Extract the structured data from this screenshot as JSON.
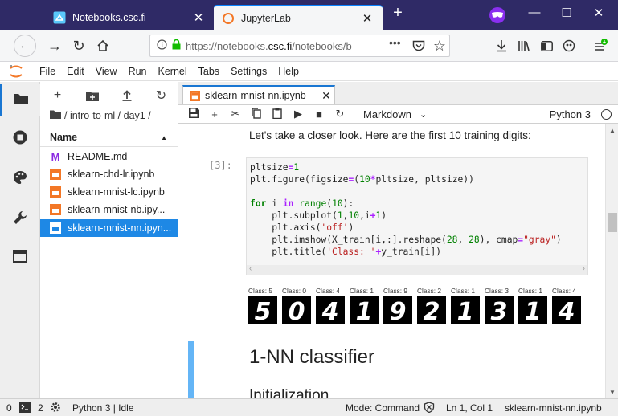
{
  "browser": {
    "tabs": [
      {
        "title": "Notebooks.csc.fi",
        "active": false
      },
      {
        "title": "JupyterLab",
        "active": true
      }
    ],
    "url": {
      "prefix": "https://notebooks.",
      "host": "csc.fi",
      "path": "/notebooks/b"
    }
  },
  "menu": [
    "File",
    "Edit",
    "View",
    "Run",
    "Kernel",
    "Tabs",
    "Settings",
    "Help"
  ],
  "filebrowser": {
    "breadcrumb": "/ intro-to-ml / day1 /",
    "column_name": "Name",
    "files": [
      {
        "name": "README.md",
        "type": "markdown"
      },
      {
        "name": "sklearn-chd-lr.ipynb",
        "type": "notebook"
      },
      {
        "name": "sklearn-mnist-lc.ipynb",
        "type": "notebook"
      },
      {
        "name": "sklearn-mnist-nb.ipy...",
        "type": "notebook"
      },
      {
        "name": "sklearn-mnist-nn.ipyn...",
        "type": "notebook",
        "selected": true
      }
    ]
  },
  "notebook": {
    "tab_title": "sklearn-mnist-nn.ipynb",
    "cell_type": "Markdown",
    "kernel": "Python 3",
    "markdown_text": "Let's take a closer look. Here are the first 10 training digits:",
    "prompt": "[3]:",
    "digits": [
      {
        "label": "Class: 5",
        "digit": "5"
      },
      {
        "label": "Class: 0",
        "digit": "0"
      },
      {
        "label": "Class: 4",
        "digit": "4"
      },
      {
        "label": "Class: 1",
        "digit": "1"
      },
      {
        "label": "Class: 9",
        "digit": "9"
      },
      {
        "label": "Class: 2",
        "digit": "2"
      },
      {
        "label": "Class: 1",
        "digit": "1"
      },
      {
        "label": "Class: 3",
        "digit": "3"
      },
      {
        "label": "Class: 1",
        "digit": "1"
      },
      {
        "label": "Class: 4",
        "digit": "4"
      }
    ],
    "heading1": "1-NN classifier",
    "heading2": "Initialization"
  },
  "status": {
    "terminals": "0",
    "kernels": "2",
    "kernel_state": "Python 3 | Idle",
    "mode": "Mode: Command",
    "position": "Ln 1, Col 1",
    "file": "sklearn-mnist-nn.ipynb"
  },
  "colors": {
    "accent": "#1976d2",
    "selected_row": "#1e88e5",
    "browser_tabbar": "#2f2a66"
  }
}
